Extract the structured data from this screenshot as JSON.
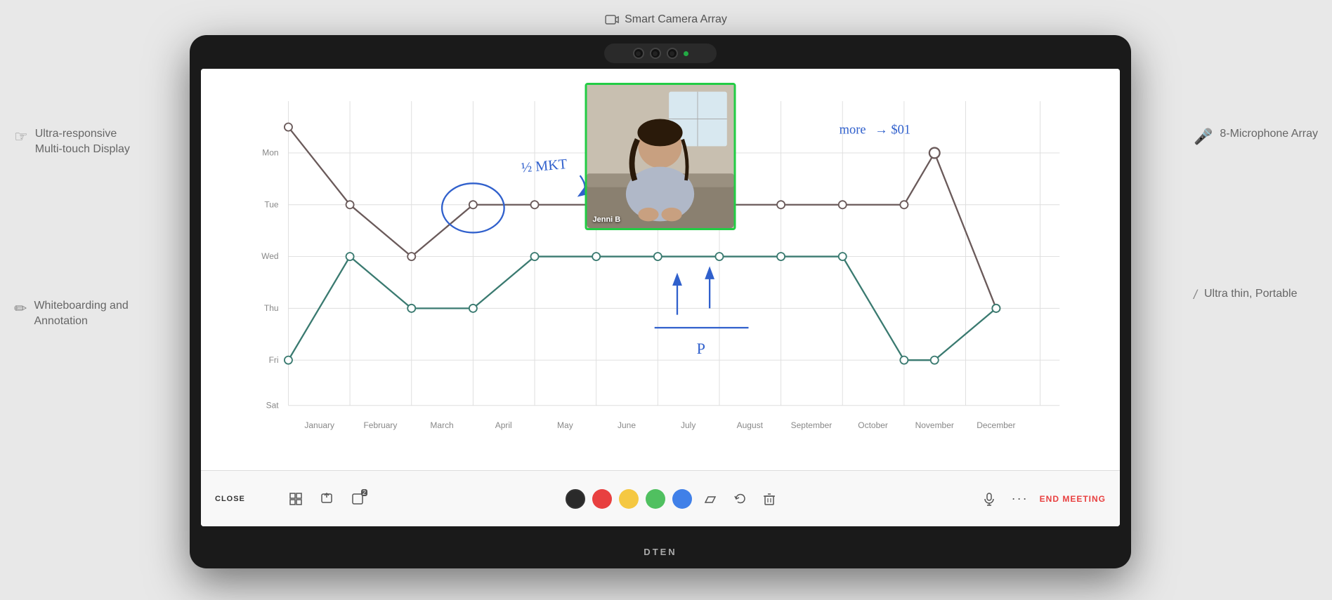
{
  "top_label": {
    "icon": "📷",
    "text": "Smart Camera Array"
  },
  "left_features": [
    {
      "id": "multitouch",
      "icon": "☝",
      "line1": "Ultra-responsive",
      "line2": "Multi-touch Display"
    },
    {
      "id": "whiteboard",
      "icon": "✏",
      "line1": "Whiteboarding and",
      "line2": "Annotation"
    }
  ],
  "right_features": [
    {
      "id": "microphone",
      "icon": "🎤",
      "text": "8-Microphone Array"
    },
    {
      "id": "portable",
      "icon": "/",
      "text": "Ultra thin, Portable"
    }
  ],
  "brand": "DTEN",
  "video_participant": "Jenni B",
  "toolbar": {
    "close_label": "CLOSE",
    "end_meeting_label": "END MEETING",
    "colors": [
      "dark",
      "red",
      "yellow",
      "green",
      "blue"
    ]
  },
  "chart": {
    "x_labels": [
      "January",
      "February",
      "March",
      "April",
      "May",
      "June",
      "July",
      "August",
      "September",
      "October",
      "November",
      "December"
    ],
    "y_labels": [
      "Mon",
      "Tue",
      "Wed",
      "Thu",
      "Fri",
      "Sat"
    ]
  }
}
